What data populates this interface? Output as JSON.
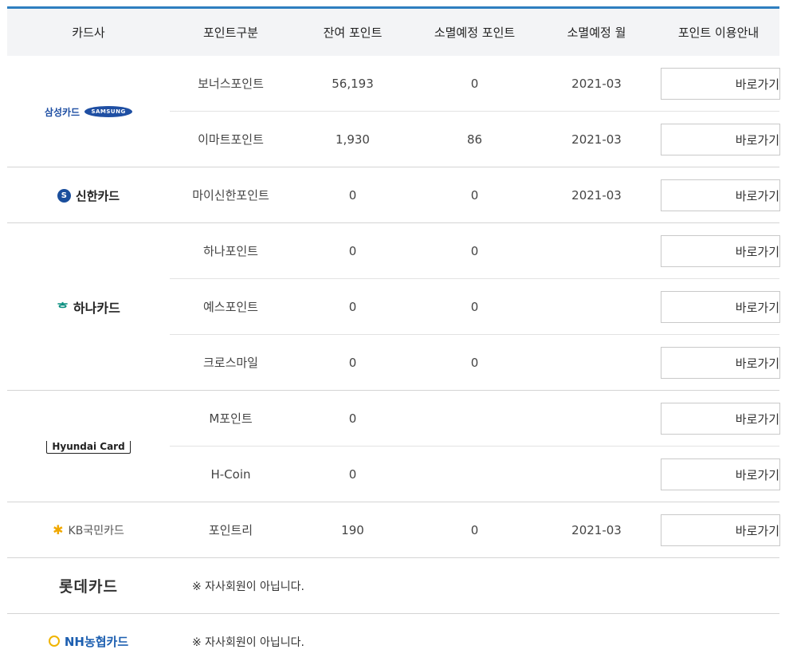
{
  "header": {
    "card_company": "카드사",
    "point_type": "포인트구분",
    "balance": "잔여 포인트",
    "expiring_points": "소멸예정 포인트",
    "expiring_month": "소멸예정 월",
    "guide": "포인트 이용안내"
  },
  "button_label": "바로가기",
  "brands": {
    "samsung": {
      "text": "삼성카드",
      "badge": "SAMSUNG",
      "icon": "samsung-logo"
    },
    "shinhan": {
      "text": "신한카드",
      "mark": "S",
      "icon": "shinhan-logo"
    },
    "hana": {
      "text": "하나카드",
      "mark": "ᄒ",
      "icon": "hana-logo"
    },
    "hyundai": {
      "text": "Hyundai Card",
      "icon": "hyundai-logo"
    },
    "kb": {
      "text": "KB국민카드",
      "mark": "✱",
      "icon": "kb-logo"
    },
    "lotte": {
      "text": "롯데카드",
      "icon": "lotte-logo"
    },
    "nh": {
      "text": "NH농협카드",
      "icon": "nh-logo"
    }
  },
  "rows": [
    {
      "type": "보너스포인트",
      "balance": "56,193",
      "expiring": "0",
      "month": "2021-03"
    },
    {
      "type": "이마트포인트",
      "balance": "1,930",
      "expiring": "86",
      "month": "2021-03"
    },
    {
      "type": "마이신한포인트",
      "balance": "0",
      "expiring": "0",
      "month": "2021-03"
    },
    {
      "type": "하나포인트",
      "balance": "0",
      "expiring": "0",
      "month": ""
    },
    {
      "type": "예스포인트",
      "balance": "0",
      "expiring": "0",
      "month": ""
    },
    {
      "type": "크로스마일",
      "balance": "0",
      "expiring": "0",
      "month": ""
    },
    {
      "type": "M포인트",
      "balance": "0",
      "expiring": "",
      "month": ""
    },
    {
      "type": "H-Coin",
      "balance": "0",
      "expiring": "",
      "month": ""
    },
    {
      "type": "포인트리",
      "balance": "190",
      "expiring": "0",
      "month": "2021-03"
    }
  ],
  "not_member_note": "※ 자사회원이 아닙니다.",
  "colors": {
    "accent_line": "#2f7fc0",
    "header_bg": "#f3f4f6"
  }
}
